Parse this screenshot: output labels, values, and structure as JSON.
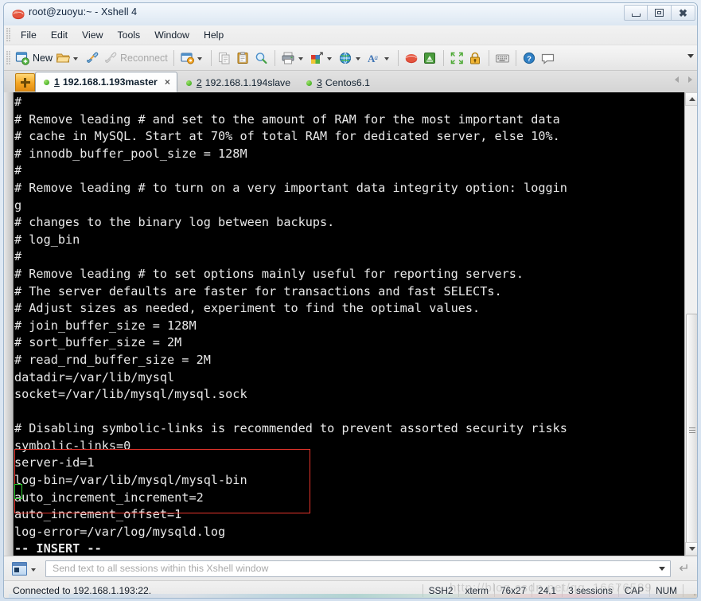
{
  "window": {
    "title": "root@zuoyu:~ - Xshell 4",
    "app_icon": "xshell-icon",
    "minimize_label": "Minimize",
    "restore_label": "Restore",
    "close_label": "Close"
  },
  "menubar": {
    "items": [
      "File",
      "Edit",
      "View",
      "Tools",
      "Window",
      "Help"
    ]
  },
  "toolbar": {
    "new_label": "New",
    "reconnect_label": "Reconnect",
    "items": [
      {
        "name": "new-session",
        "icon": "new-window-icon",
        "label": "New"
      },
      {
        "name": "open-session",
        "icon": "open-folder-icon",
        "label": ""
      },
      {
        "name": "connect",
        "icon": "connect-plug-icon",
        "label": ""
      },
      {
        "name": "reconnect",
        "icon": "reconnect-plug-icon",
        "label": "Reconnect"
      },
      {
        "name": "session-properties",
        "icon": "properties-gear-icon",
        "label": ""
      },
      {
        "name": "copy",
        "icon": "copy-icon",
        "label": ""
      },
      {
        "name": "paste",
        "icon": "paste-clipboard-icon",
        "label": ""
      },
      {
        "name": "find",
        "icon": "magnifier-icon",
        "label": ""
      },
      {
        "name": "print",
        "icon": "printer-icon",
        "label": ""
      },
      {
        "name": "color-scheme",
        "icon": "color-palette-icon",
        "label": ""
      },
      {
        "name": "web-transfer",
        "icon": "globe-icon",
        "label": ""
      },
      {
        "name": "font-settings",
        "icon": "font-a-icon",
        "label": ""
      },
      {
        "name": "xshell-transfer",
        "icon": "xshell-red-icon",
        "label": ""
      },
      {
        "name": "xftp-transfer",
        "icon": "xftp-green-icon",
        "label": ""
      },
      {
        "name": "full-screen",
        "icon": "fullscreen-arrows-icon",
        "label": ""
      },
      {
        "name": "lock",
        "icon": "lock-icon",
        "label": ""
      },
      {
        "name": "keyboard",
        "icon": "keyboard-icon",
        "label": ""
      },
      {
        "name": "help",
        "icon": "help-question-icon",
        "label": ""
      },
      {
        "name": "feedback",
        "icon": "speech-bubble-icon",
        "label": ""
      }
    ]
  },
  "tabs": {
    "new_tab_label": "+",
    "items": [
      {
        "number": "1",
        "label": "192.168.1.193master",
        "active": true,
        "closable": true
      },
      {
        "number": "2",
        "label": "192.168.1.194slave",
        "active": false,
        "closable": false
      },
      {
        "number": "3",
        "label": "Centos6.1",
        "active": false,
        "closable": false
      }
    ],
    "close_glyph": "×"
  },
  "terminal": {
    "lines": [
      "#",
      "# Remove leading # and set to the amount of RAM for the most important data",
      "# cache in MySQL. Start at 70% of total RAM for dedicated server, else 10%.",
      "# innodb_buffer_pool_size = 128M",
      "#",
      "# Remove leading # to turn on a very important data integrity option: loggin",
      "g",
      "# changes to the binary log between backups.",
      "# log_bin",
      "#",
      "# Remove leading # to set options mainly useful for reporting servers.",
      "# The server defaults are faster for transactions and fast SELECTs.",
      "# Adjust sizes as needed, experiment to find the optimal values.",
      "# join_buffer_size = 128M",
      "# sort_buffer_size = 2M",
      "# read_rnd_buffer_size = 2M",
      "datadir=/var/lib/mysql",
      "socket=/var/lib/mysql/mysql.sock",
      "",
      "# Disabling symbolic-links is recommended to prevent assorted security risks",
      "symbolic-links=0",
      "server-id=1",
      "log-bin=/var/lib/mysql/mysql-bin",
      "auto_increment_increment=2",
      "auto_increment_offset=1",
      "log-error=/var/log/mysqld.log"
    ],
    "mode_line": "-- INSERT --",
    "annotation_box_color": "#e8352c",
    "cursor_color": "#2ecc2e",
    "background_color": "#000000",
    "foreground_color": "#e8e8e8"
  },
  "send_bar": {
    "placeholder": "Send text to all sessions within this Xshell window",
    "value": "",
    "target_icon": "terminal-window-icon",
    "enter_icon": "enter-arrow-icon"
  },
  "status_bar": {
    "connection": "Connected to 192.168.1.193:22.",
    "cells": [
      "SSH2",
      "xterm",
      "76x27",
      "24,1",
      "3 sessions",
      "CAP",
      "NUM"
    ],
    "watermark": "http://blog.csdn.net/qq_16676589"
  }
}
